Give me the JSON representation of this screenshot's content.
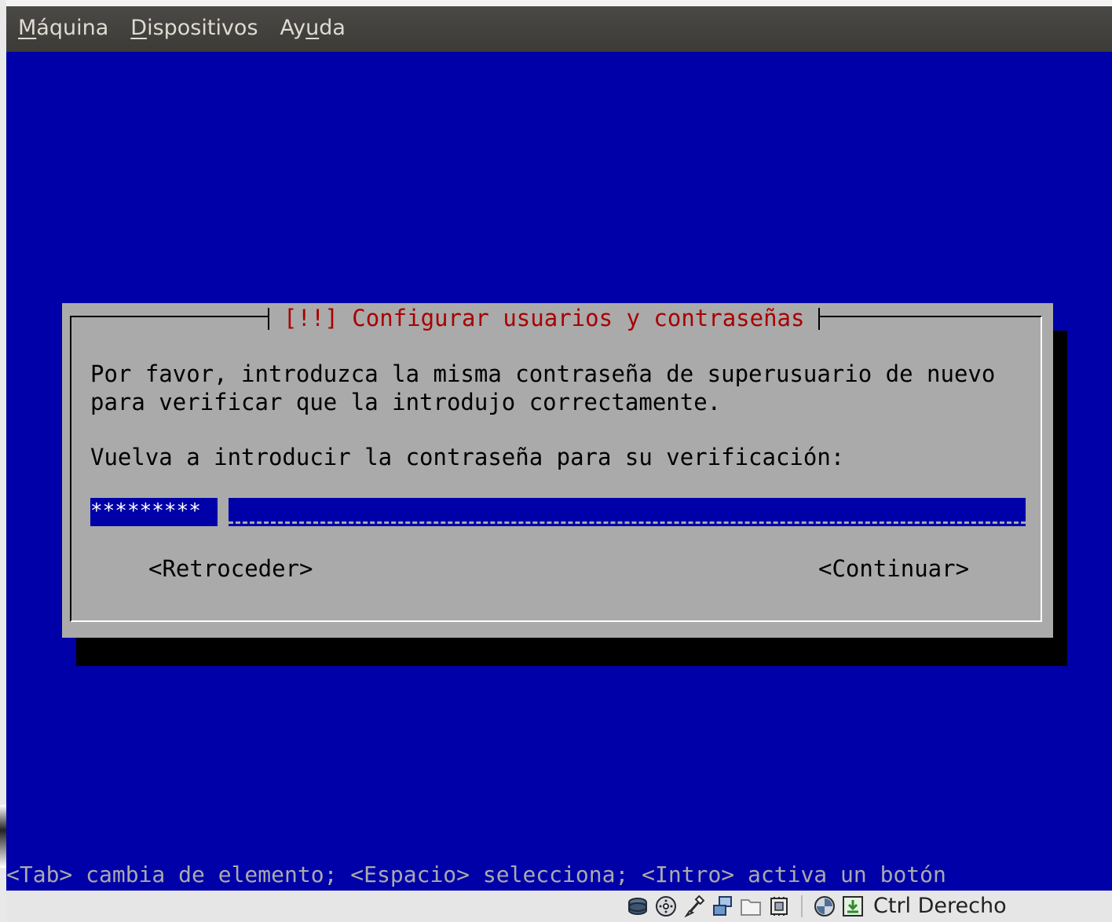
{
  "menubar": {
    "items": [
      {
        "pre": "",
        "mnemonic": "M",
        "post": "áquina"
      },
      {
        "pre": "",
        "mnemonic": "D",
        "post": "ispositivos"
      },
      {
        "pre": "Ay",
        "mnemonic": "u",
        "post": "da"
      }
    ]
  },
  "dialog": {
    "title": "[!!] Configurar usuarios y contraseñas",
    "message_line1": "Por favor, introduzca la misma contraseña de superusuario de nuevo",
    "message_line2": "para verificar que la introdujo correctamente.",
    "prompt": "Vuelva a introducir la contraseña para su verificación:",
    "password_value": "*********",
    "back_button": "<Retroceder>",
    "continue_button": "<Continuar>"
  },
  "helpline": "<Tab> cambia de elemento; <Espacio> selecciona; <Intro> activa un botón",
  "statusbar": {
    "icons": [
      "hard-disk-icon",
      "optical-drive-icon",
      "usb-icon",
      "network-icon",
      "shared-folder-icon",
      "video-capture-icon",
      "virtualization-icon",
      "mouse-integration-icon"
    ],
    "host_key_label": "Ctrl Derecho"
  },
  "colors": {
    "screen_background": "#0000a8",
    "dialog_background": "#aaaaaa",
    "dialog_title": "#a80000",
    "menubar_background": "#3c3b37"
  }
}
